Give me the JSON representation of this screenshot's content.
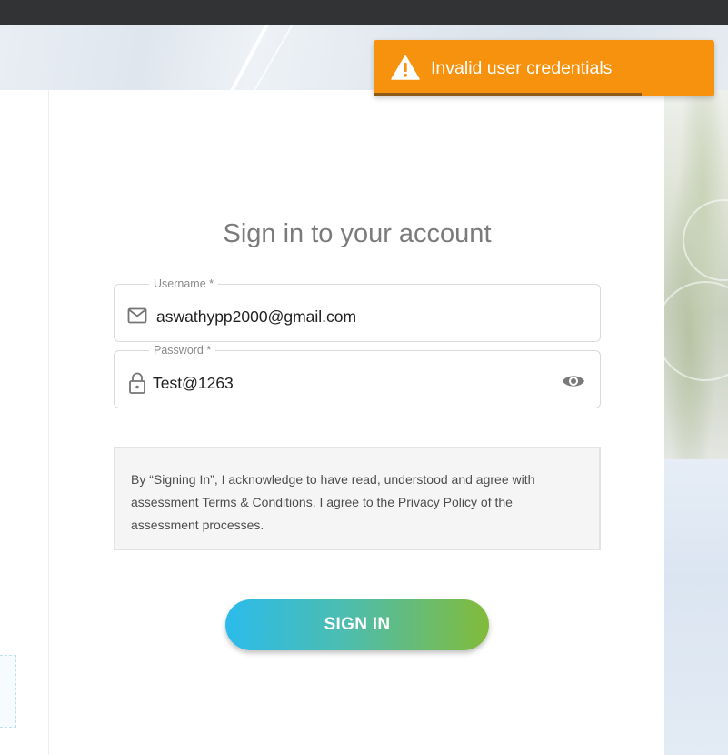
{
  "toast": {
    "message": "Invalid user credentials",
    "icon": "warning-icon",
    "color": "#f7920e",
    "progress_remaining": 0.786
  },
  "login": {
    "title": "Sign in to your account",
    "username": {
      "label": "Username *",
      "value": "aswathypp2000@gmail.com",
      "icon": "mail-icon"
    },
    "password": {
      "label": "Password *",
      "value": "Test@1263",
      "icon": "lock-icon",
      "toggle_icon": "eye-icon"
    },
    "terms_text": "By “Signing In”, I acknowledge to have read, understood and agree with assessment Terms & Conditions. I agree to the Privacy Policy of the assessment processes.",
    "signin_label": "SIGN IN",
    "button_gradient": [
      "#2bbbeb",
      "#82bb3a"
    ]
  }
}
